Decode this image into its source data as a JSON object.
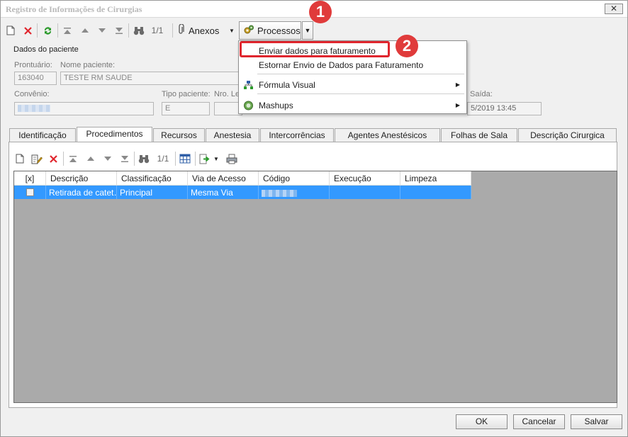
{
  "window": {
    "title": "Registro de Informações de Cirurgias",
    "close_glyph": "✕"
  },
  "toolbar": {
    "record_count": "1/1",
    "anexos_label": "Anexos",
    "processos_label": "Processos"
  },
  "patient": {
    "group_label": "Dados do paciente",
    "prontuario_label": "Prontuário:",
    "prontuario_value": "163040",
    "nome_label": "Nome paciente:",
    "nome_value": "TESTE RM SAUDE",
    "convenio_label": "Convênio:",
    "tipo_label": "Tipo paciente:",
    "tipo_value": "E",
    "nro_label": "Nro. Le",
    "saida_label": "Saída:",
    "saida_value": "5/2019 13:45"
  },
  "tabs": [
    {
      "label": "Identificação"
    },
    {
      "label": "Procedimentos"
    },
    {
      "label": "Recursos"
    },
    {
      "label": "Anestesia"
    },
    {
      "label": "Intercorrências"
    },
    {
      "label": "Agentes Anestésicos"
    },
    {
      "label": "Folhas de Sala"
    },
    {
      "label": "Descrição Cirurgica"
    }
  ],
  "active_tab": "Procedimentos",
  "subtoolbar": {
    "record_count": "1/1"
  },
  "grid": {
    "columns": [
      "[x]",
      "Descrição",
      "Classificação",
      "Via de Acesso",
      "Código",
      "Execução",
      "Limpeza"
    ],
    "rows": [
      {
        "checked": false,
        "descricao": "Retirada de catet…",
        "classificacao": "Principal",
        "via": "Mesma Via",
        "codigo": "",
        "execucao": "",
        "limpeza": ""
      }
    ]
  },
  "menu": {
    "items": [
      {
        "label": "Enviar dados para faturamento",
        "has_submenu": false
      },
      {
        "label": "Estornar Envio de Dados para Faturamento",
        "has_submenu": false
      },
      {
        "label": "Fórmula Visual",
        "has_submenu": true
      },
      {
        "label": "Mashups",
        "has_submenu": true
      }
    ]
  },
  "annotations": {
    "badge1": "1",
    "badge2": "2"
  },
  "buttons": {
    "ok": "OK",
    "cancel": "Cancelar",
    "save": "Salvar"
  },
  "colors": {
    "selection": "#3399ff",
    "annotation_red": "#e03b3b",
    "grid_bg": "#aaaaaa"
  },
  "icons": [
    "new-icon",
    "delete-icon",
    "refresh-icon",
    "first-icon",
    "prev-icon",
    "next-icon",
    "last-icon",
    "binoculars-icon",
    "paperclip-icon",
    "gears-icon",
    "edit-icon",
    "grid-icon",
    "export-icon",
    "print-icon"
  ]
}
